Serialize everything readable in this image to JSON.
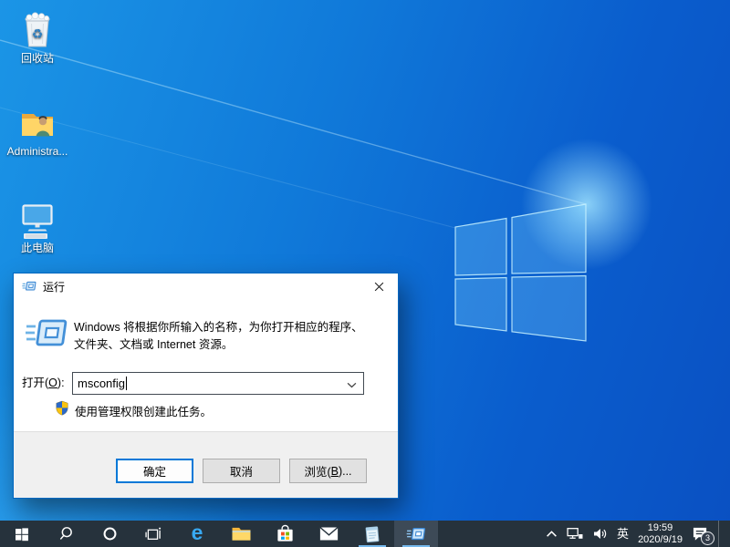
{
  "desktop": {
    "icons": [
      {
        "label": "回收站"
      },
      {
        "label": "Administra..."
      },
      {
        "label": "此电脑"
      }
    ]
  },
  "dialog": {
    "title": "运行",
    "description": {
      "line1": "Windows 将根据你所输入的名称，为你打开相应的程序、",
      "line2": "文件夹、文档或 Internet 资源。"
    },
    "open_label": {
      "pre": "打开(",
      "key": "O",
      "post": "):"
    },
    "input": {
      "value": "msconfig"
    },
    "admin_note": "使用管理权限创建此任务。",
    "buttons": {
      "ok": "确定",
      "cancel": "取消",
      "browse": {
        "pre": "浏览(",
        "key": "B",
        "post": ")..."
      }
    }
  },
  "taskbar": {
    "edge_glyph": "e",
    "tray": {
      "ime": "英",
      "time": "19:59",
      "date": "2020/9/19",
      "notification_count": "3"
    }
  },
  "colors": {
    "accent": "#0078d7",
    "dialog_border": "#0067c0",
    "taskbar_background": "#26323c",
    "taskbar_indicator": "#76b9ed",
    "wallpaper_left": "#1b95e6",
    "wallpaper_right": "#0a50c2"
  }
}
